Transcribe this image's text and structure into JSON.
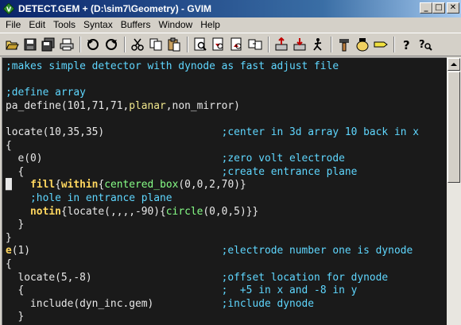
{
  "window": {
    "title": "DETECT.GEM + (D:\\sim7\\Geometry) - GVIM",
    "minimize": "_",
    "maximize": "□",
    "close": "✕"
  },
  "menu": [
    "File",
    "Edit",
    "Tools",
    "Syntax",
    "Buffers",
    "Window",
    "Help"
  ],
  "toolbar": {
    "buttons": [
      "open-icon",
      "save-icon",
      "save-all-icon",
      "print-icon",
      "undo-icon",
      "redo-icon",
      "cut-icon",
      "copy-icon",
      "paste-icon",
      "find-icon",
      "find-next-icon",
      "find-prev-icon",
      "replace-icon",
      "load-session-icon",
      "save-session-icon",
      "run-script-icon",
      "make-icon",
      "shell-icon",
      "tag-icon",
      "help-icon",
      "find-help-icon"
    ]
  },
  "code_lines": [
    [
      [
        ";makes simple detector with dynode as fast adjust file",
        "comment"
      ]
    ],
    [],
    [
      [
        ";define array",
        "comment"
      ]
    ],
    [
      [
        "pa_define(101,71,71,",
        "ident"
      ],
      [
        "planar",
        "func"
      ],
      [
        ",non_mirror)",
        "ident"
      ]
    ],
    [],
    [
      [
        "locate(10,35,35)                   ",
        "ident"
      ],
      [
        ";center in 3d array 10 back in x",
        "comment"
      ]
    ],
    [
      [
        "{",
        "ident"
      ]
    ],
    [
      [
        "  e(0)                             ",
        "ident"
      ],
      [
        ";zero volt electrode",
        "comment"
      ]
    ],
    [
      [
        "  {                                ",
        "ident"
      ],
      [
        ";create entrance plane",
        "comment"
      ]
    ],
    [
      [
        "█",
        "cursor"
      ],
      [
        "   ",
        "ident"
      ],
      [
        "fill",
        "kw"
      ],
      [
        "{",
        "ident"
      ],
      [
        "within",
        "kw"
      ],
      [
        "{",
        "ident"
      ],
      [
        "centered_box",
        "green"
      ],
      [
        "(0,0,2,70)}",
        "ident"
      ]
    ],
    [
      [
        "    ",
        "ident"
      ],
      [
        ";hole in entrance plane",
        "comment"
      ]
    ],
    [
      [
        "    ",
        "ident"
      ],
      [
        "notin",
        "kw"
      ],
      [
        "{locate(,,,,-90){",
        "ident"
      ],
      [
        "circle",
        "green"
      ],
      [
        "(0,0,5)}}",
        "ident"
      ]
    ],
    [
      [
        "  }",
        "ident"
      ]
    ],
    [
      [
        "}",
        "ident"
      ]
    ],
    [
      [
        "e",
        "kw"
      ],
      [
        "(1)                               ",
        "ident"
      ],
      [
        ";electrode number one is dynode",
        "comment"
      ]
    ],
    [
      [
        "{",
        "ident"
      ]
    ],
    [
      [
        "  locate(5,-8)                     ",
        "ident"
      ],
      [
        ";offset location for dynode",
        "comment"
      ]
    ],
    [
      [
        "  {                                ",
        "ident"
      ],
      [
        ";  +5 in x and -8 in y",
        "comment"
      ]
    ],
    [
      [
        "    include(dyn_inc.gem)           ",
        "ident"
      ],
      [
        ";include dynode",
        "comment"
      ]
    ],
    [
      [
        "  }",
        "ident"
      ]
    ]
  ]
}
